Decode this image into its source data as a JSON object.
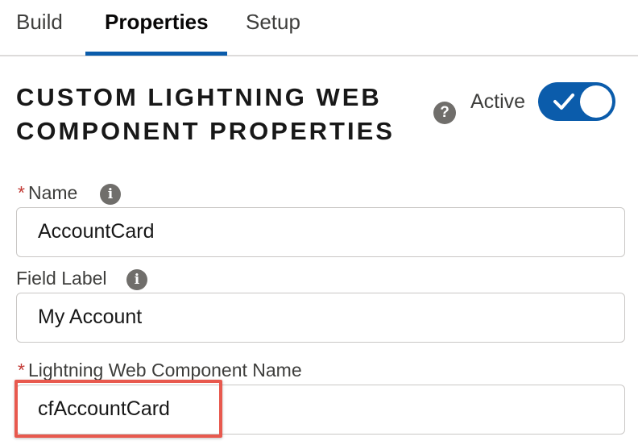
{
  "tabs": [
    {
      "label": "Build",
      "active": false
    },
    {
      "label": "Properties",
      "active": true
    },
    {
      "label": "Setup",
      "active": false
    }
  ],
  "header": {
    "title_line1": "CUSTOM LIGHTNING WEB",
    "title_line2": "COMPONENT PROPERTIES",
    "active_label": "Active",
    "active_toggle_on": true,
    "help_icon": "question-circle-icon"
  },
  "fields": {
    "name": {
      "label": "Name",
      "required": true,
      "value": "AccountCard",
      "info_icon": "info-icon"
    },
    "field_label": {
      "label": "Field Label",
      "required": false,
      "value": "My Account",
      "info_icon": "info-icon"
    },
    "lwc_name": {
      "label": "Lightning Web Component Name",
      "required": true,
      "value": "cfAccountCard"
    }
  },
  "colors": {
    "brand": "#0b5cab",
    "required": "#c23934",
    "highlight": "#e8594e",
    "border": "#c9c7c5"
  }
}
